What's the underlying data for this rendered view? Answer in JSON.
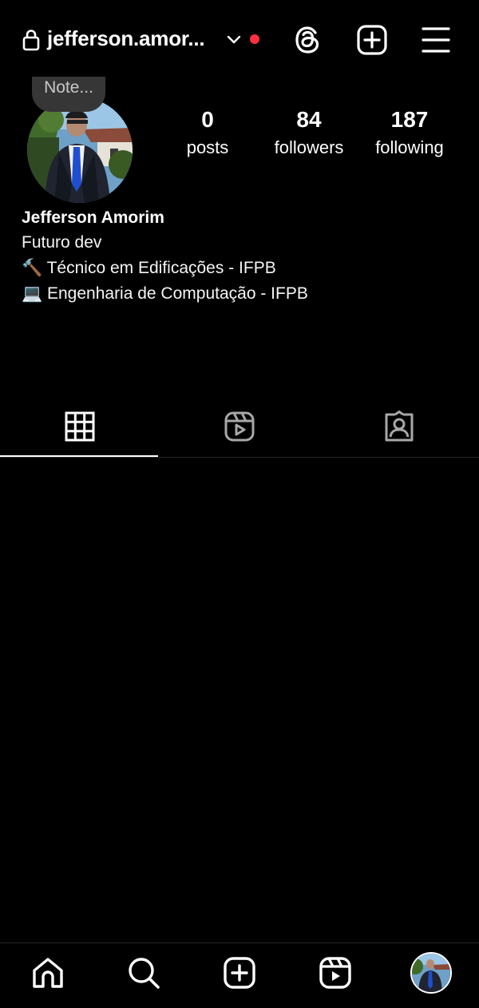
{
  "header": {
    "username": "jefferson.amor...",
    "lock_icon": "lock-icon",
    "switch_account_icon": "chevron-down-icon",
    "notification_dot_color": "#ff3040",
    "actions": [
      "threads-icon",
      "create-icon",
      "menu-icon"
    ]
  },
  "profile": {
    "note": "Note...",
    "stats": [
      {
        "value": "0",
        "label": "posts"
      },
      {
        "value": "84",
        "label": "followers"
      },
      {
        "value": "187",
        "label": "following"
      }
    ],
    "full_name": "Jefferson Amorim",
    "bio": [
      "Futuro dev",
      "🔨 Técnico em Edificações - IFPB",
      "💻 Engenharia de Computação - IFPB"
    ]
  },
  "tabs": [
    {
      "icon": "grid-icon",
      "active": true
    },
    {
      "icon": "reels-icon",
      "active": false
    },
    {
      "icon": "tagged-icon",
      "active": false
    }
  ],
  "bottom_nav": [
    "home-icon",
    "search-icon",
    "create-icon",
    "reels-icon",
    "profile-avatar"
  ],
  "colors": {
    "background": "#000000",
    "text": "#ffffff",
    "note_bubble": "#363636",
    "divider": "#262626",
    "inactive_icon": "#a8a8a8"
  }
}
